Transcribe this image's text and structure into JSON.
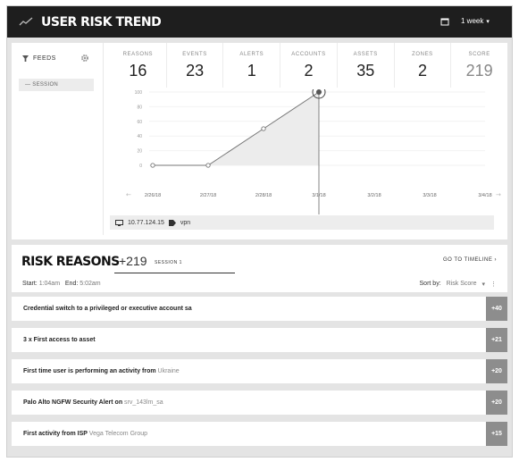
{
  "header": {
    "title": "USER RISK TREND",
    "range": "1 week"
  },
  "feeds": {
    "label": "FEEDS",
    "session_item": "SESSION"
  },
  "metrics": [
    {
      "label": "REASONS",
      "value": "16"
    },
    {
      "label": "EVENTS",
      "value": "23"
    },
    {
      "label": "ALERTS",
      "value": "1"
    },
    {
      "label": "ACCOUNTS",
      "value": "2"
    },
    {
      "label": "ASSETS",
      "value": "35"
    },
    {
      "label": "ZONES",
      "value": "2"
    },
    {
      "label": "SCORE",
      "value": "219"
    }
  ],
  "chart_data": {
    "type": "line",
    "x": [
      "2/26/18",
      "2/27/18",
      "2/28/18",
      "3/1/18",
      "3/2/18",
      "3/3/18",
      "3/4/18"
    ],
    "y_ticks": [
      0,
      20,
      40,
      60,
      80,
      100
    ],
    "ylim": [
      0,
      100
    ],
    "points": [
      {
        "x": "2/26/18",
        "y": 0
      },
      {
        "x": "2/27/18",
        "y": 0
      },
      {
        "x": "2/28/18",
        "y": 50
      },
      {
        "x": "3/1/18",
        "y": 100
      }
    ],
    "highlight": "3/1/18",
    "area_fill": true
  },
  "info": {
    "ip": "10.77.124.15",
    "tag": "vpn"
  },
  "risk_reasons": {
    "title": "RISK REASONS",
    "score": "+219",
    "session_label": "SESSION 1",
    "timeline_link": "GO TO TIMELINE",
    "start_label": "Start:",
    "start_value": "1:04am",
    "end_label": "End:",
    "end_value": "5:02am",
    "sort_label": "Sort by:",
    "sort_value": "Risk Score"
  },
  "reasons": [
    {
      "text": "Credential switch to a privileged or executive account sa",
      "highlight": "",
      "score": "+40"
    },
    {
      "text": "3 x First access to asset",
      "highlight": "",
      "score": "+21"
    },
    {
      "text": "First time user is performing an activity from ",
      "highlight": "Ukraine",
      "score": "+20"
    },
    {
      "text": "Palo Alto NGFW Security Alert on ",
      "highlight": "srv_143lm_sa",
      "score": "+20"
    },
    {
      "text": "First activity from ISP ",
      "highlight": "Vega Telecom Group",
      "score": "+15"
    }
  ]
}
